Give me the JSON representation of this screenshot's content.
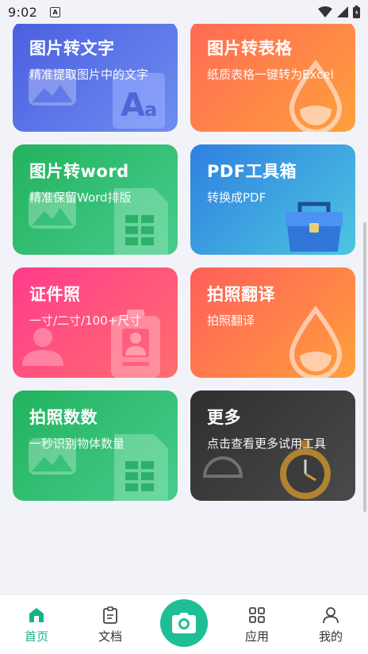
{
  "status_bar": {
    "time": "9:02",
    "notif_letter": "A"
  },
  "cards": [
    {
      "title": "图片转文字",
      "desc": "精准提取图片中的文字",
      "gradient": [
        "#4a5fe0",
        "#6f8df0"
      ],
      "icon": "text-ocr-icon"
    },
    {
      "title": "图片转表格",
      "desc": "纸质表格一键转为Excel",
      "gradient": [
        "#ff6a55",
        "#ffa03c"
      ],
      "icon": "drop-icon"
    },
    {
      "title": "图片转word",
      "desc": "精准保留Word排版",
      "gradient": [
        "#22b35e",
        "#47cc8c"
      ],
      "icon": "doc-grid-icon"
    },
    {
      "title": "PDF工具箱",
      "desc": "转换成PDF",
      "gradient": [
        "#2f7fe0",
        "#4cc6e0"
      ],
      "icon": "toolbox-icon"
    },
    {
      "title": "证件照",
      "desc": "一寸/二寸/100+尺寸",
      "gradient": [
        "#ff3c8c",
        "#ff6d6d"
      ],
      "icon": "id-badge-icon"
    },
    {
      "title": "拍照翻译",
      "desc": "拍照翻译",
      "gradient": [
        "#ff5e5a",
        "#ffa03c"
      ],
      "icon": "drop-icon"
    },
    {
      "title": "拍照数数",
      "desc": "一秒识别物体数量",
      "gradient": [
        "#22b35e",
        "#47cc8c"
      ],
      "icon": "doc-grid-icon"
    },
    {
      "title": "更多",
      "desc": "点击查看更多试用工具",
      "gradient": [
        "#2f2f2f",
        "#4a4a4a"
      ],
      "icon": "stopwatch-icon"
    }
  ],
  "tabbar": {
    "home": "首页",
    "docs": "文档",
    "apps": "应用",
    "mine": "我的"
  },
  "colors": {
    "accent": "#13b38a",
    "camera": "#1fbe95"
  }
}
